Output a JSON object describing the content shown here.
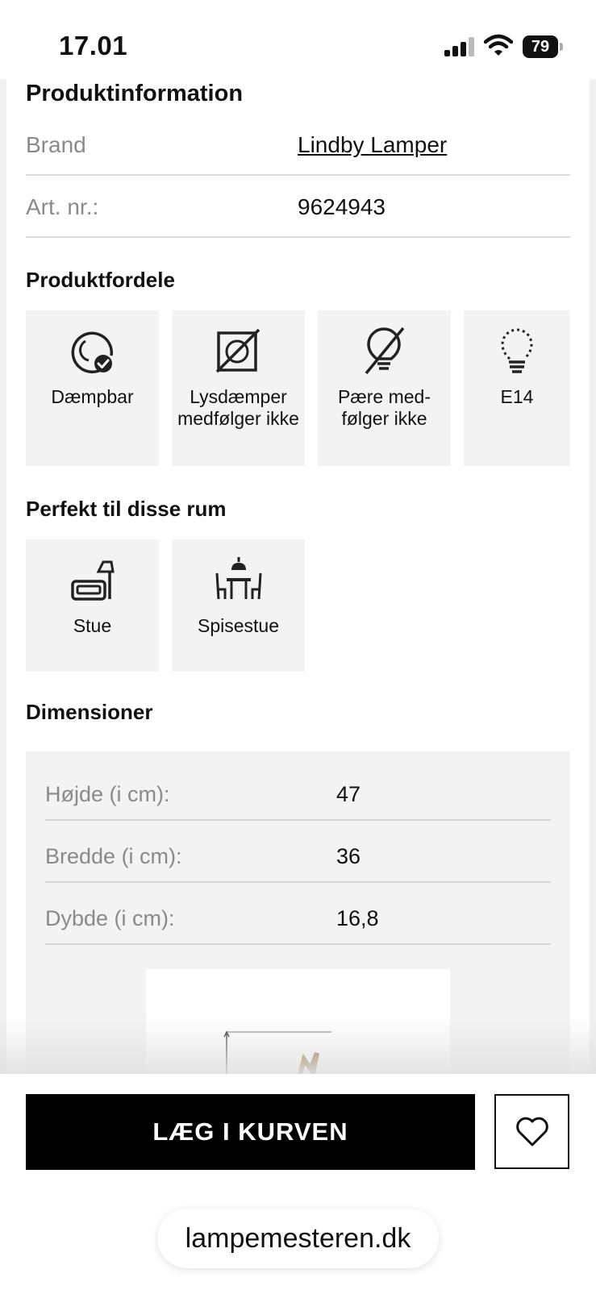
{
  "status_bar": {
    "time": "17.01",
    "battery": "79"
  },
  "product_info": {
    "heading": "Produktinformation",
    "rows": [
      {
        "label": "Brand",
        "value": "Lindby Lamper"
      },
      {
        "label": "Art. nr.:",
        "value": "9624943"
      }
    ]
  },
  "benefits": {
    "heading": "Produktfordele",
    "items": [
      {
        "label": "Dæmpbar",
        "icon": "dimmable-icon"
      },
      {
        "label": "Lysdæmper medfølger ikke",
        "icon": "no-dimmer-icon"
      },
      {
        "label": "Pære med-følger ikke",
        "icon": "no-bulb-icon"
      },
      {
        "label": "E14",
        "icon": "bulb-e14-icon"
      }
    ]
  },
  "rooms": {
    "heading": "Perfekt til disse rum",
    "items": [
      {
        "label": "Stue",
        "icon": "living-room-icon"
      },
      {
        "label": "Spisestue",
        "icon": "dining-room-icon"
      }
    ]
  },
  "dimensions": {
    "heading": "Dimensioner",
    "rows": [
      {
        "label": "Højde (i cm):",
        "value": "47"
      },
      {
        "label": "Bredde (i cm):",
        "value": "36"
      },
      {
        "label": "Dybde (i cm):",
        "value": "16,8"
      }
    ]
  },
  "actions": {
    "cart_label": "LÆG I KURVEN",
    "favorite_icon": "heart-icon"
  },
  "browser": {
    "url": "lampemesteren.dk"
  }
}
